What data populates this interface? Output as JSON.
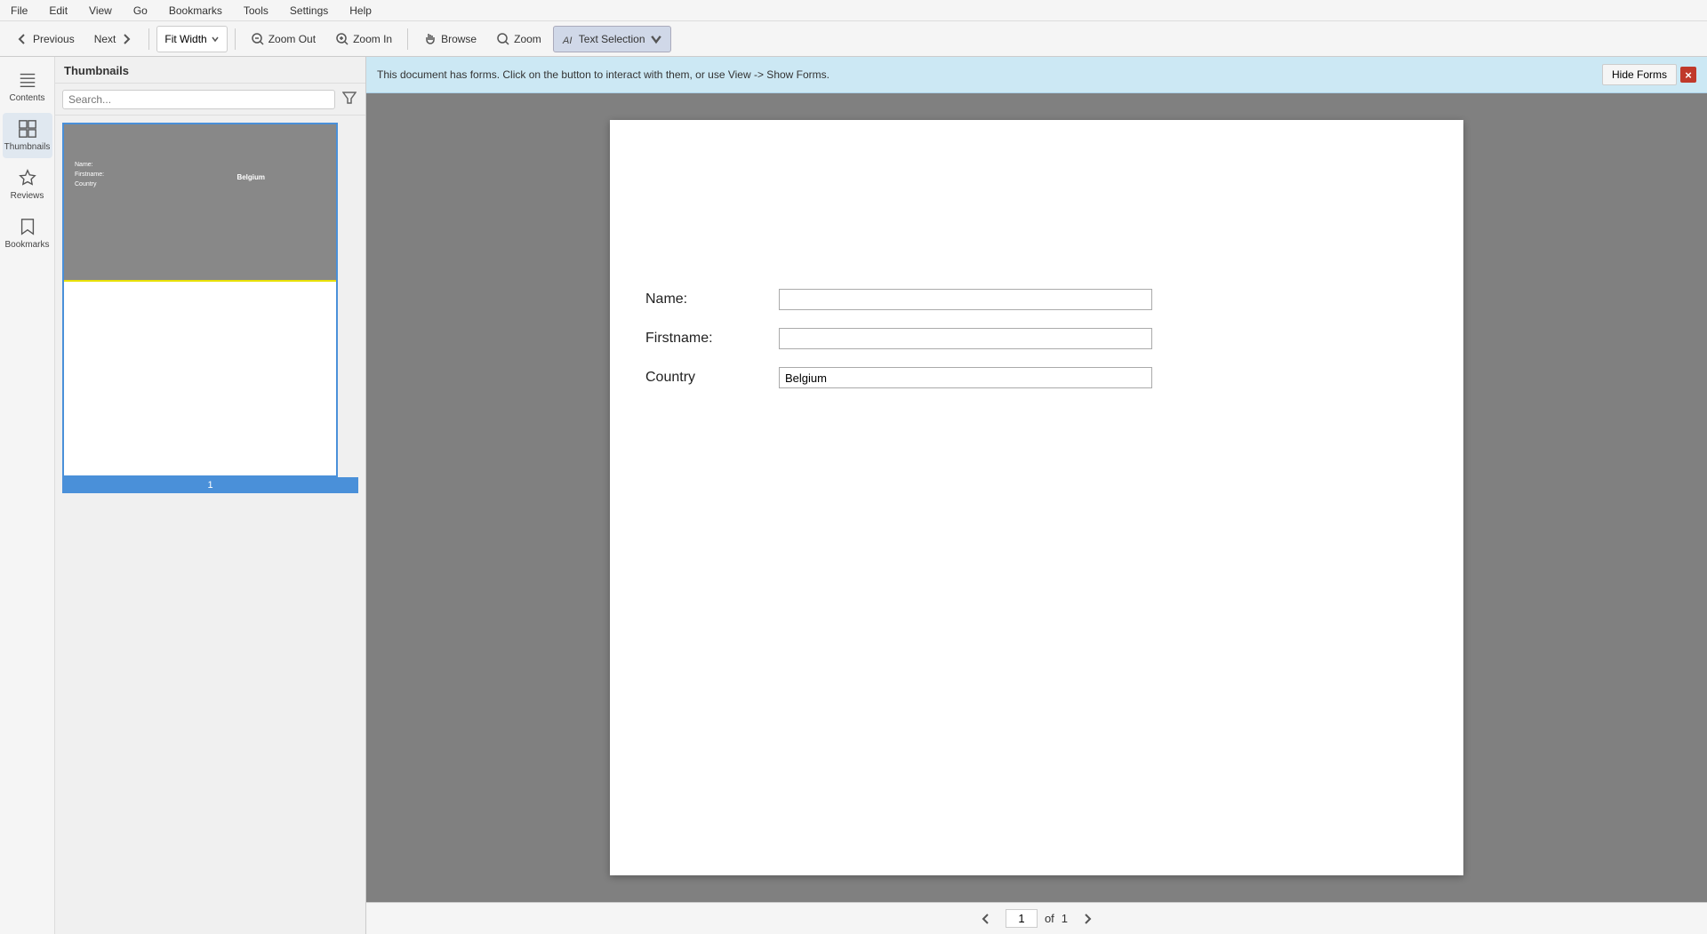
{
  "menubar": {
    "items": [
      "File",
      "Edit",
      "View",
      "Go",
      "Bookmarks",
      "Tools",
      "Settings",
      "Help"
    ]
  },
  "toolbar": {
    "prev_label": "Previous",
    "next_label": "Next",
    "fit_width_label": "Fit Width",
    "zoom_out_label": "Zoom Out",
    "zoom_in_label": "Zoom In",
    "browse_label": "Browse",
    "zoom_label": "Zoom",
    "text_selection_label": "Text Selection"
  },
  "sidebar": {
    "contents_label": "Contents",
    "thumbnails_label": "Thumbnails",
    "reviews_label": "Reviews",
    "bookmarks_label": "Bookmarks"
  },
  "thumbnails_panel": {
    "title": "Thumbnails",
    "search_placeholder": "Search...",
    "page_number": "1"
  },
  "forms_banner": {
    "message": "This document has forms. Click on the button to interact with them, or use View -> Show Forms.",
    "hide_forms_label": "Hide Forms"
  },
  "document": {
    "fields": [
      {
        "label": "Name:",
        "value": "",
        "placeholder": ""
      },
      {
        "label": "Firstname:",
        "value": "",
        "placeholder": ""
      },
      {
        "label": "Country",
        "value": "Belgium",
        "placeholder": ""
      }
    ]
  },
  "page_nav": {
    "current": "1",
    "of_label": "of",
    "total": "1"
  }
}
